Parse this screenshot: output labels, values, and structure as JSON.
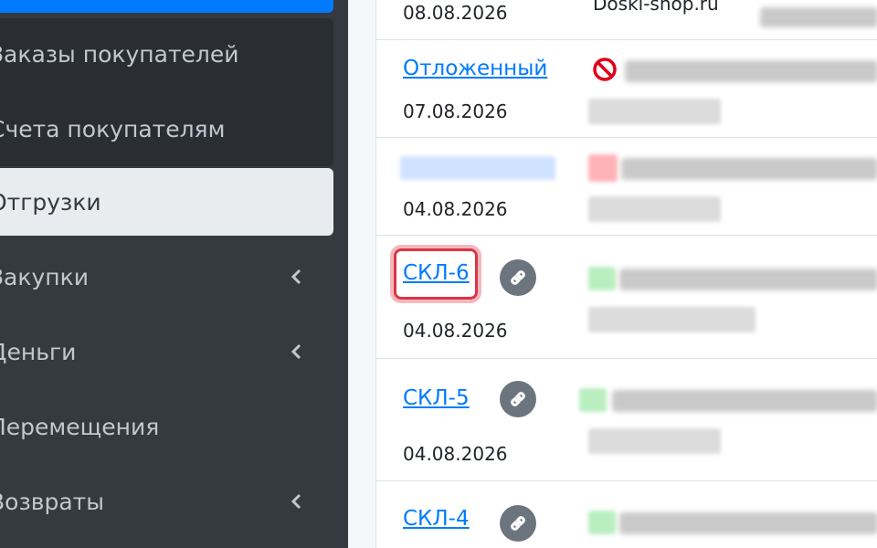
{
  "sidebar": {
    "items": [
      {
        "label": "Заказы покупателей",
        "active": false,
        "has_submenu": false
      },
      {
        "label": "Счета покупателям",
        "active": false,
        "has_submenu": false
      },
      {
        "label": "Отгрузки",
        "active": true,
        "has_submenu": false
      },
      {
        "label": "Закупки",
        "active": false,
        "has_submenu": true
      },
      {
        "label": "Деньги",
        "active": false,
        "has_submenu": true
      },
      {
        "label": "Перемещения",
        "active": false,
        "has_submenu": false
      },
      {
        "label": "Возвраты",
        "active": false,
        "has_submenu": true
      }
    ],
    "chevron_icon": "chevron-left-icon"
  },
  "table": {
    "rows": [
      {
        "doc": "",
        "date": "08.08.2026",
        "site": "Doski-shop.ru"
      },
      {
        "doc": "Отложенный",
        "date": "07.08.2026",
        "status_icon": "prohibited-icon"
      },
      {
        "doc": "",
        "date": "04.08.2026"
      },
      {
        "doc": "СКЛ-6",
        "date": "04.08.2026",
        "action_icon": "link-icon",
        "highlighted": true
      },
      {
        "doc": "СКЛ-5",
        "date": "04.08.2026",
        "action_icon": "link-icon"
      },
      {
        "doc": "СКЛ-4",
        "date": "",
        "action_icon": "link-icon"
      }
    ]
  },
  "colors": {
    "sidebar_bg": "#343a40",
    "active_item_bg": "#e9ecef",
    "link": "#007bff",
    "highlight": "#dc3545"
  }
}
